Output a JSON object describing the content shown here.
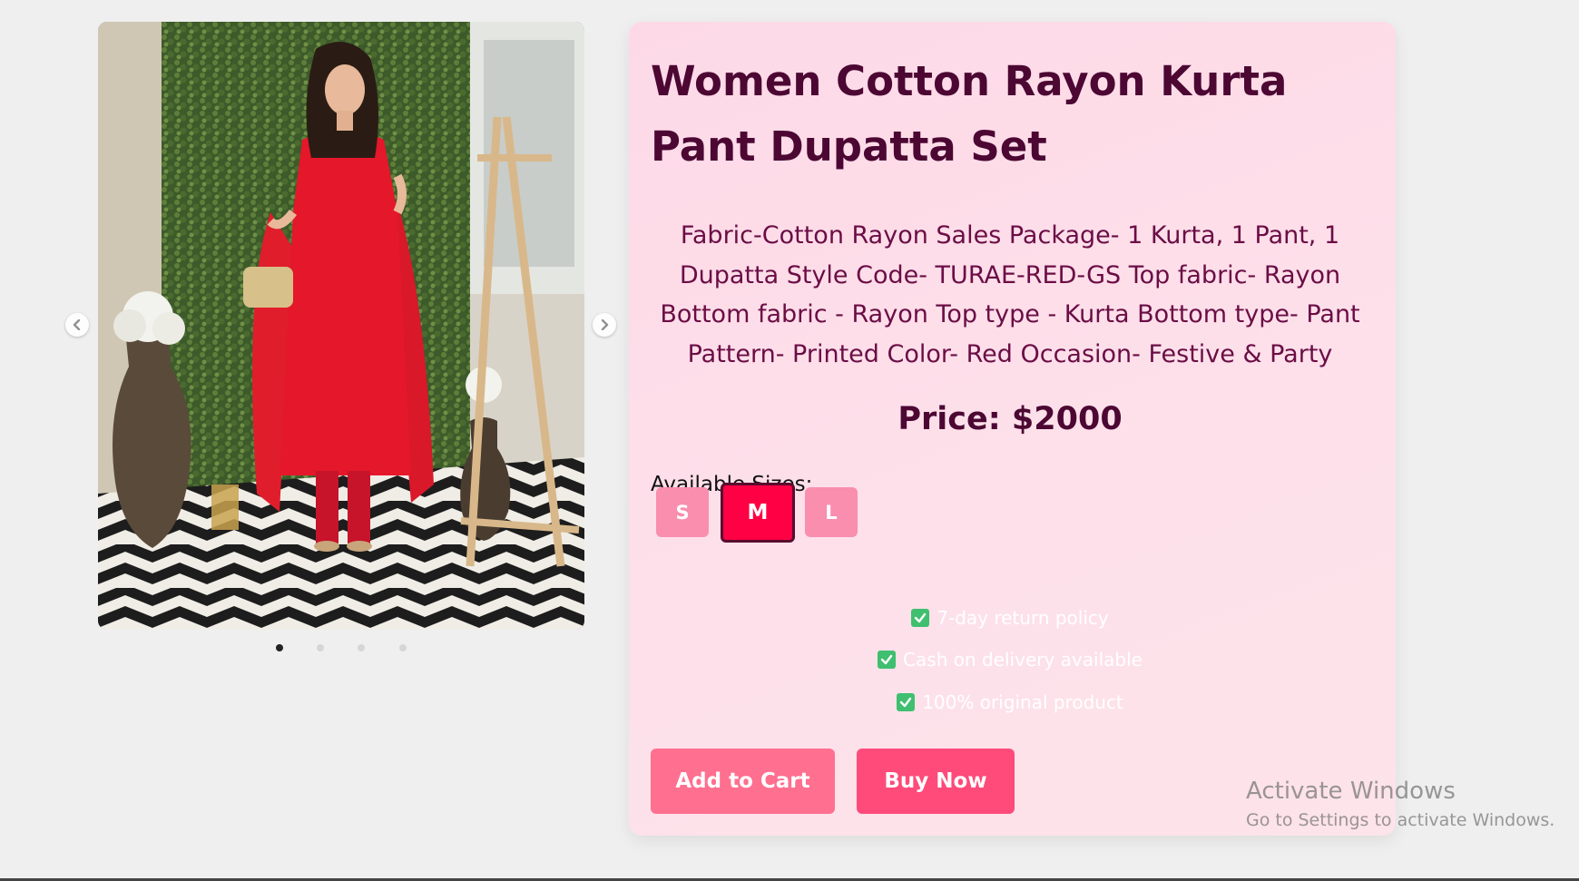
{
  "product": {
    "title": "Women Cotton Rayon Kurta Pant Dupatta Set",
    "description": "Fabric-Cotton Rayon Sales Package- 1 Kurta, 1 Pant, 1 Dupatta Style Code- TURAE-RED-GS Top fabric- Rayon Bottom fabric - Rayon Top type - Kurta Bottom type- Pant Pattern- Printed Color- Red Occasion- Festive & Party",
    "price_text": "Price: $2000"
  },
  "sizes": {
    "label": "Available Sizes:",
    "options": [
      "S",
      "M",
      "L"
    ],
    "selected": "M"
  },
  "perks": [
    "7-day return policy",
    "Cash on delivery available",
    "100% original product"
  ],
  "actions": {
    "add_to_cart": "Add to Cart",
    "buy_now": "Buy Now"
  },
  "carousel": {
    "slide_count": 4,
    "active_slide": 1
  },
  "watermark": {
    "title": "Activate Windows",
    "subtitle": "Go to Settings to activate Windows."
  },
  "colors": {
    "page_bg": "#efefef",
    "card_bg": "#fde0ea",
    "title": "#4c0733",
    "description": "#6b0d45",
    "size_button": "#f98eae",
    "size_selected": "#ff0044",
    "add_to_cart": "#ff6f8f",
    "buy_now": "#fe4b7a",
    "check": "#3fbf6f"
  }
}
